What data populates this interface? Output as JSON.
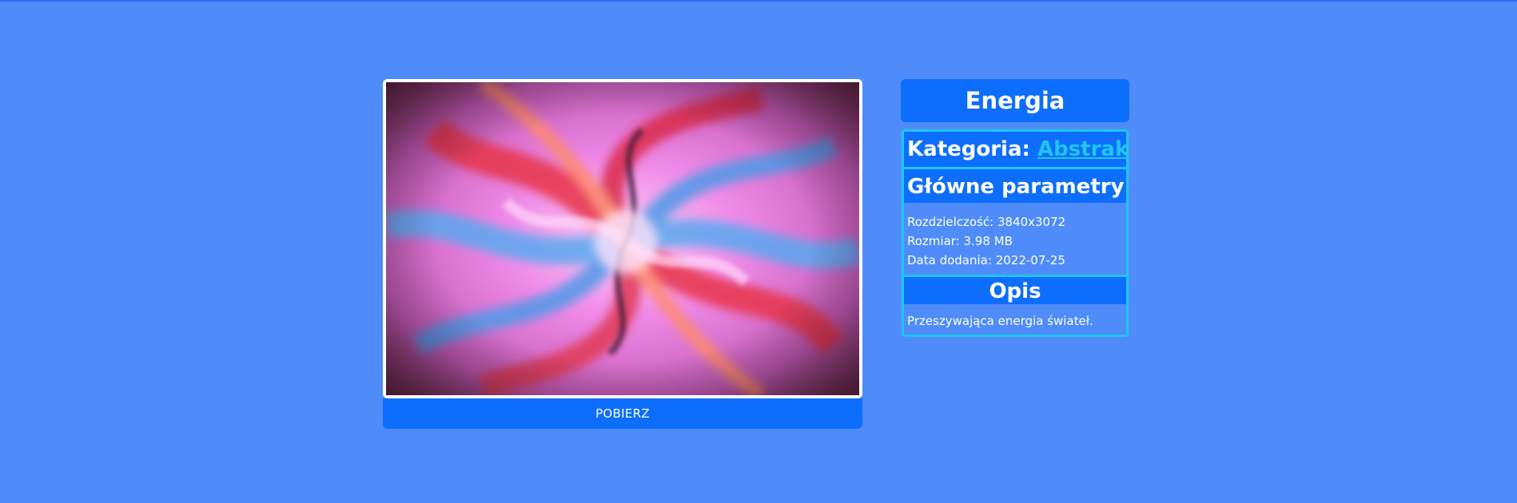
{
  "image": {
    "alt_icon": "abstract-swirl-image",
    "download_label": "POBIERZ"
  },
  "details": {
    "title": "Energia",
    "category_label": "Kategoria: ",
    "category_value": "Abstrakcja",
    "params_heading": "Główne parametry:",
    "params": [
      {
        "label": "Rozdzielczość: ",
        "value": "3840x3072"
      },
      {
        "label": "Rozmiar: ",
        "value": "3.98 MB"
      },
      {
        "label": "Data dodania: ",
        "value": "2022-07-25"
      }
    ],
    "description_heading": "Opis",
    "description": "Przeszywająca energia świateł."
  },
  "colors": {
    "page_background": "#4f8cfa",
    "primary": "#0d6efd",
    "accent": "#1ec6f0",
    "text": "#ffffff"
  }
}
